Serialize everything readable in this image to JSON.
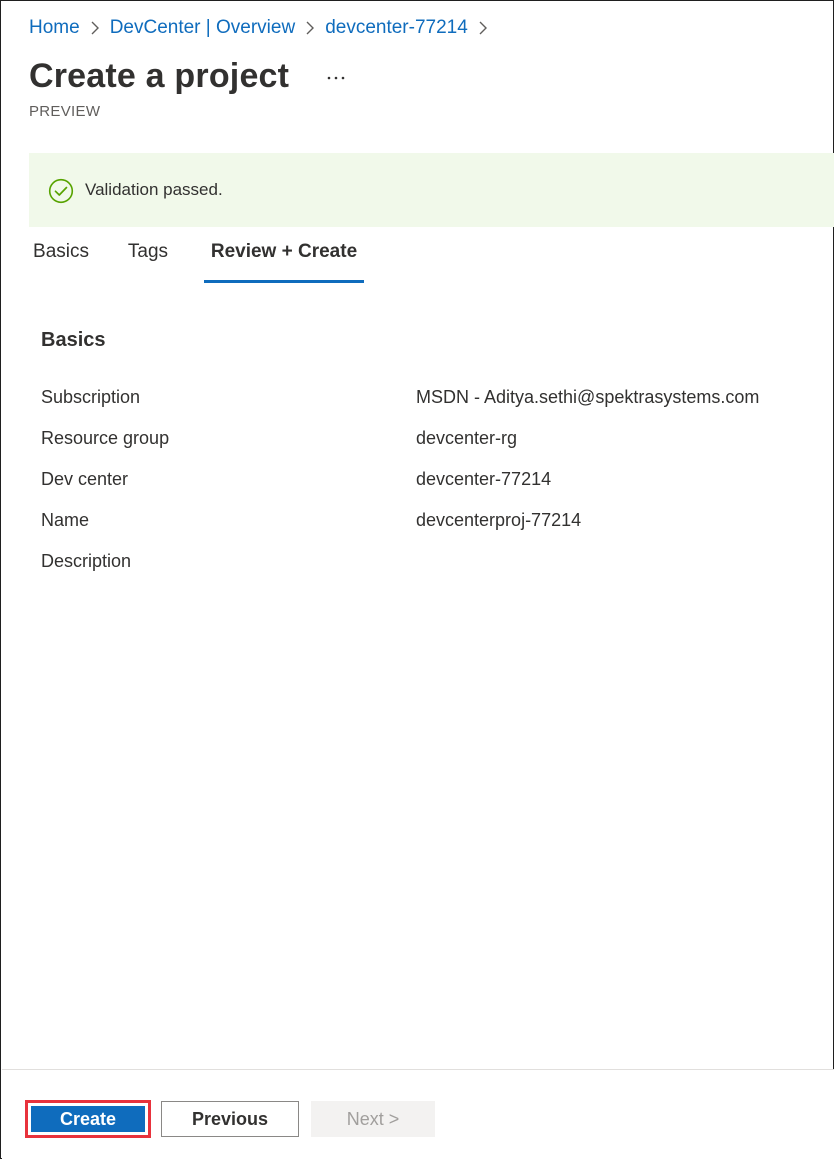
{
  "breadcrumb": {
    "items": [
      "Home",
      "DevCenter | Overview",
      "devcenter-77214"
    ]
  },
  "header": {
    "title": "Create a project",
    "more_label": "···",
    "subtitle": "PREVIEW"
  },
  "banner": {
    "message": "Validation passed.",
    "icon": "check-circle-icon",
    "color": "#57a300"
  },
  "tabs": [
    {
      "label": "Basics",
      "selected": false
    },
    {
      "label": "Tags",
      "selected": false
    },
    {
      "label": "Review + Create",
      "selected": true
    }
  ],
  "summary": {
    "heading": "Basics",
    "rows": [
      {
        "label": "Subscription",
        "value": "MSDN - Aditya.sethi@spektrasystems.com"
      },
      {
        "label": "Resource group",
        "value": "devcenter-rg"
      },
      {
        "label": "Dev center",
        "value": "devcenter-77214"
      },
      {
        "label": "Name",
        "value": "devcenterproj-77214"
      },
      {
        "label": "Description",
        "value": ""
      }
    ]
  },
  "footer": {
    "create_label": "Create",
    "previous_label": "Previous",
    "next_label": "Next >"
  },
  "colors": {
    "accent": "#0f6cbd",
    "success_bg": "#f1f9ea",
    "highlight": "#e8323c"
  }
}
